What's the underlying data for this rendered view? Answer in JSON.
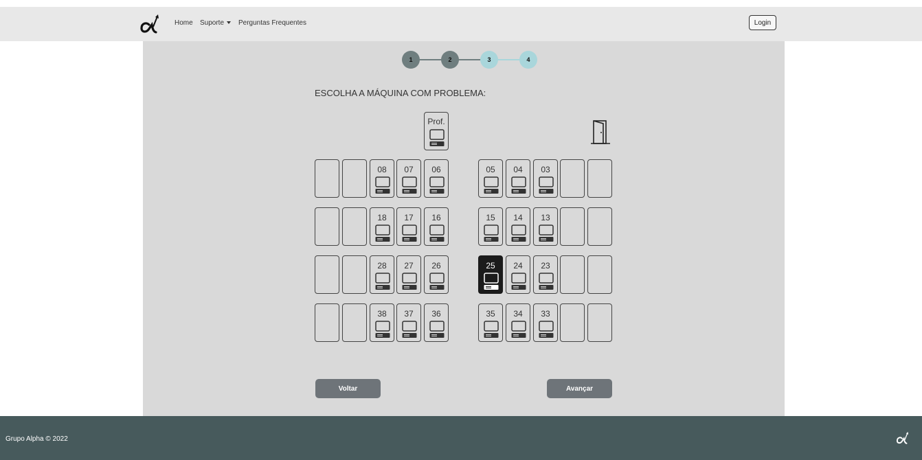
{
  "nav": {
    "home": "Home",
    "suporte": "Suporte",
    "faq": "Perguntas Frequentes",
    "login": "Login"
  },
  "steps": [
    {
      "label": "1",
      "state": "done"
    },
    {
      "label": "2",
      "state": "done"
    },
    {
      "label": "3",
      "state": "todo"
    },
    {
      "label": "4",
      "state": "todo"
    }
  ],
  "title": "ESCOLHA A MÁQUINA COM PROBLEMA:",
  "professor": "Prof.",
  "rows": [
    {
      "left": [
        "",
        "",
        "08",
        "07",
        "06"
      ],
      "right": [
        "05",
        "04",
        "03",
        "",
        ""
      ]
    },
    {
      "left": [
        "",
        "",
        "18",
        "17",
        "16"
      ],
      "right": [
        "15",
        "14",
        "13",
        "",
        ""
      ]
    },
    {
      "left": [
        "",
        "",
        "28",
        "27",
        "26"
      ],
      "right": [
        "25",
        "24",
        "23",
        "",
        ""
      ]
    },
    {
      "left": [
        "",
        "",
        "38",
        "37",
        "36"
      ],
      "right": [
        "35",
        "34",
        "33",
        "",
        ""
      ]
    }
  ],
  "selected": "25",
  "buttons": {
    "back": "Voltar",
    "next": "Avançar"
  },
  "footer": {
    "text": "Grupo Alpha © 2022"
  },
  "colors": {
    "step_done": "#6f7e7f",
    "step_todo": "#a9d6db",
    "selected_seat": "#1b1b1b",
    "footer_bg": "#475a5c",
    "button_bg": "#6e7479"
  }
}
